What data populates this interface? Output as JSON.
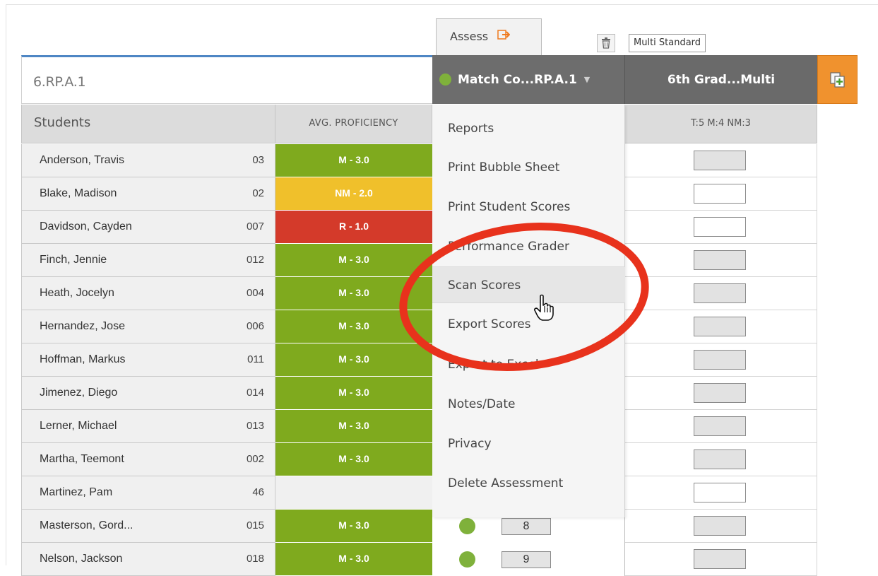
{
  "tabs": {
    "assess_label": "Assess",
    "multi_standard_label": "Multi Standard"
  },
  "standard": {
    "title": "6.RP.A.1"
  },
  "assessment_header": {
    "current": "Match Co...RP.A.1",
    "second": "6th Grad...Multi"
  },
  "columns": {
    "students": "Students",
    "avg_proficiency": "AVG. PROFICIENCY",
    "score_summary": "T:5 M:4 NM:3"
  },
  "colors": {
    "mastered": "#7faa1e",
    "near_mastery": "#f0c02b",
    "remedial": "#d43a2a",
    "none": "#f0f0f0",
    "status_dot": "#7fb13b",
    "accent_orange": "#f0922e",
    "annotation_red": "#e8321c"
  },
  "menu": {
    "items": [
      "Reports",
      "Print Bubble Sheet",
      "Print Student Scores",
      "Performance Grader",
      "Scan Scores",
      "Export Scores",
      "Export to Excel",
      "Notes/Date",
      "Privacy",
      "Delete Assessment"
    ],
    "hovered": "Scan Scores"
  },
  "students": [
    {
      "name": "Anderson, Travis",
      "id": "03",
      "avg": "M - 3.0",
      "level": "mastered",
      "score_box": "filled"
    },
    {
      "name": "Blake, Madison",
      "id": "02",
      "avg": "NM - 2.0",
      "level": "near_mastery",
      "score_box": "empty"
    },
    {
      "name": "Davidson, Cayden",
      "id": "007",
      "avg": "R - 1.0",
      "level": "remedial",
      "score_box": "empty"
    },
    {
      "name": "Finch, Jennie",
      "id": "012",
      "avg": "M - 3.0",
      "level": "mastered",
      "score_box": "filled"
    },
    {
      "name": "Heath, Jocelyn",
      "id": "004",
      "avg": "M - 3.0",
      "level": "mastered",
      "score_box": "filled"
    },
    {
      "name": "Hernandez, Jose",
      "id": "006",
      "avg": "M - 3.0",
      "level": "mastered",
      "score_box": "filled"
    },
    {
      "name": "Hoffman, Markus",
      "id": "011",
      "avg": "M - 3.0",
      "level": "mastered",
      "score_box": "filled"
    },
    {
      "name": "Jimenez, Diego",
      "id": "014",
      "avg": "M - 3.0",
      "level": "mastered",
      "score_box": "filled"
    },
    {
      "name": "Lerner, Michael",
      "id": "013",
      "avg": "M - 3.0",
      "level": "mastered",
      "score_box": "filled"
    },
    {
      "name": "Martha, Teemont",
      "id": "002",
      "avg": "M - 3.0",
      "level": "mastered",
      "score_box": "filled"
    },
    {
      "name": "Martinez, Pam",
      "id": "46",
      "avg": "",
      "level": "none",
      "score_box": "empty"
    },
    {
      "name": "Masterson, Gord...",
      "id": "015",
      "avg": "M - 3.0",
      "level": "mastered",
      "score_box": "filled",
      "mid_score": "8"
    },
    {
      "name": "Nelson, Jackson",
      "id": "018",
      "avg": "M - 3.0",
      "level": "mastered",
      "score_box": "filled",
      "mid_score": "9"
    }
  ]
}
